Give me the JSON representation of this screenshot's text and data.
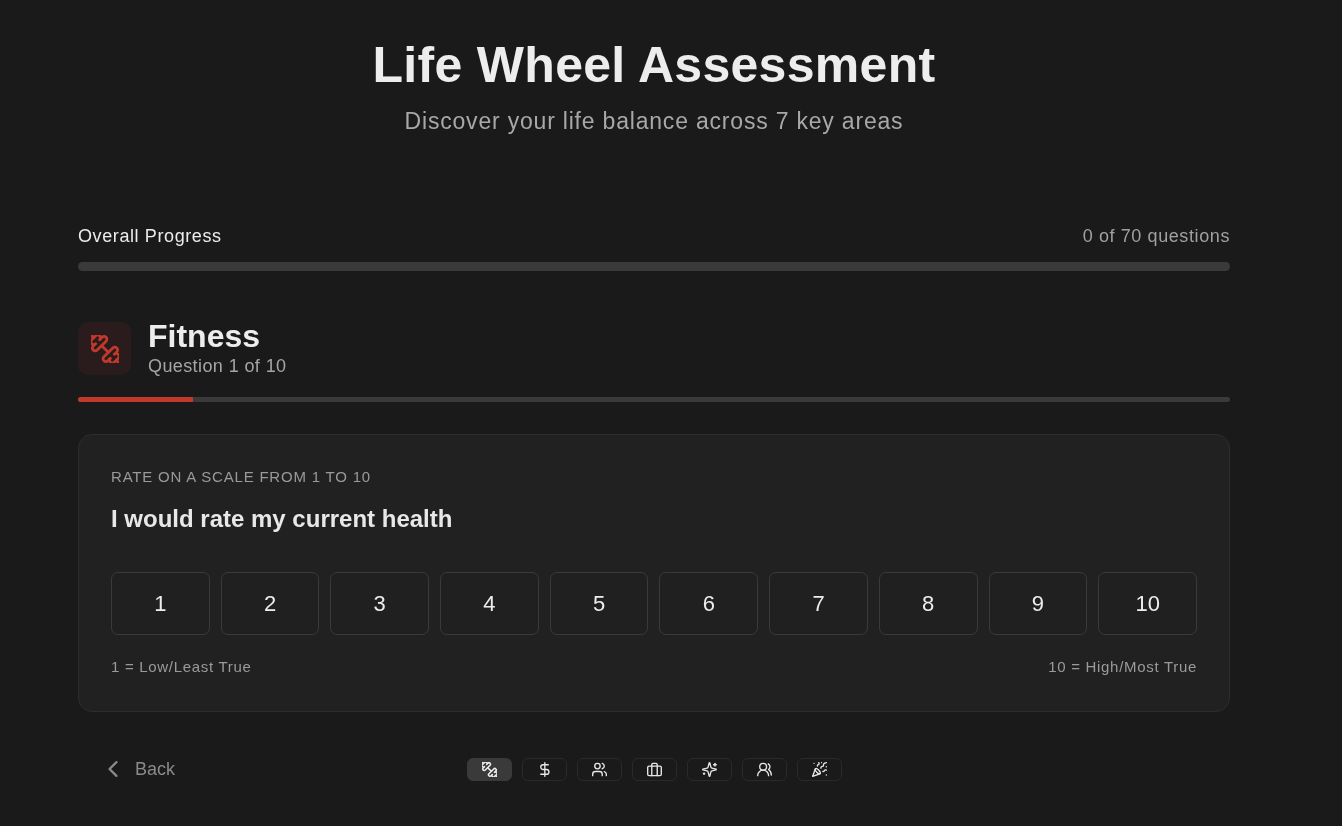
{
  "header": {
    "title": "Life Wheel Assessment",
    "subtitle": "Discover your life balance across 7 key areas"
  },
  "overall_progress": {
    "label": "Overall Progress",
    "count": "0 of 70 questions",
    "level": 0
  },
  "category": {
    "kind": "dumbbell",
    "name": "Fitness",
    "question_count": "Question 1 of 10",
    "level": 0.1
  },
  "question_card": {
    "instruction": "RATE ON A SCALE FROM 1 TO 10",
    "question": "I would rate my current health",
    "options": [
      {
        "label": "1",
        "selected": false
      },
      {
        "label": "2",
        "selected": false
      },
      {
        "label": "3",
        "selected": false
      },
      {
        "label": "4",
        "selected": false
      },
      {
        "label": "5",
        "selected": false
      },
      {
        "label": "6",
        "selected": false
      },
      {
        "label": "7",
        "selected": false
      },
      {
        "label": "8",
        "selected": false
      },
      {
        "label": "9",
        "selected": false
      },
      {
        "label": "10",
        "selected": false
      }
    ],
    "scale_low": "1 = Low/Least True",
    "scale_high": "10 = High/Most True"
  },
  "footer": {
    "back": {
      "label": "Back"
    },
    "category_nav": [
      {
        "kind": "dumbbell",
        "selected": true
      },
      {
        "kind": "dollar",
        "selected": false
      },
      {
        "kind": "people",
        "selected": false
      },
      {
        "kind": "briefcase",
        "selected": false
      },
      {
        "kind": "sparkles",
        "selected": false
      },
      {
        "kind": "users",
        "selected": false
      },
      {
        "kind": "party-popper",
        "selected": false
      }
    ]
  }
}
